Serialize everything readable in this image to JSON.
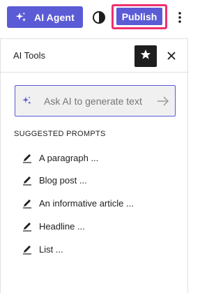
{
  "toolbar": {
    "ai_agent_label": "AI Agent",
    "publish_label": "Publish"
  },
  "panel": {
    "title": "AI Tools",
    "ask_placeholder": "Ask AI to generate text",
    "suggested_heading": "SUGGESTED PROMPTS",
    "prompts": [
      {
        "label": "A paragraph ..."
      },
      {
        "label": "Blog post ..."
      },
      {
        "label": "An informative article ..."
      },
      {
        "label": "Headline ..."
      },
      {
        "label": "List ..."
      }
    ]
  },
  "icons": {
    "ai_agent": "sparkles-icon",
    "contrast": "contrast-icon",
    "more": "more-vertical-icon",
    "star": "star-icon",
    "close": "close-icon",
    "ask_sparkles": "sparkles-icon",
    "submit": "arrow-right-icon",
    "prompt": "pencil-icon"
  },
  "colors": {
    "accent": "#5b5bd6",
    "highlight_outline": "#f0306e",
    "dark": "#1e1e1e",
    "input_bg": "#f0f0f0",
    "placeholder": "#757575"
  }
}
